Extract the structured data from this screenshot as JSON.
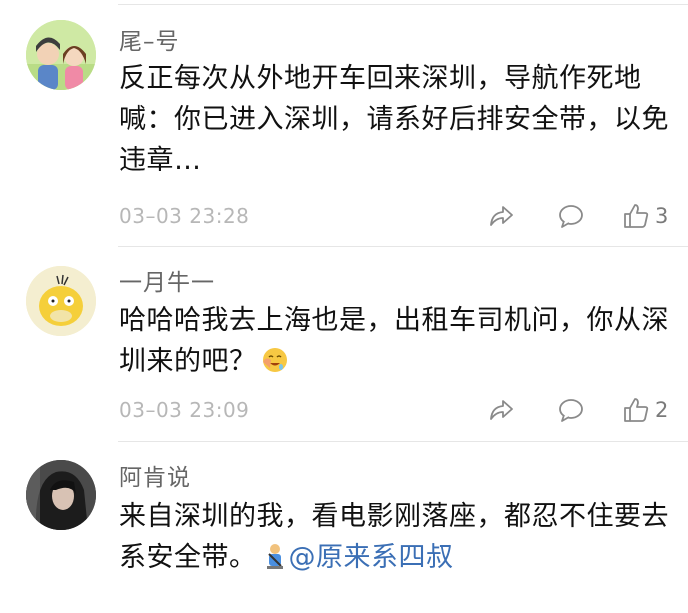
{
  "comments": [
    {
      "username": "尾–号",
      "text": "反正每次从外地开车回来深圳，导航作死地喊：你已进入深圳，请系好后排安全带，以免违章…",
      "time": "03–03 23:28",
      "likes": "3",
      "avatar_icon": "cartoon-couple-avatar"
    },
    {
      "username": "一月牛一",
      "text": "哈哈哈我去上海也是，出租车司机问，你从深圳来的吧？",
      "emoji": "drooling-face-emoji",
      "time": "03–03 23:09",
      "likes": "2",
      "avatar_icon": "psyduck-avatar"
    },
    {
      "username": "阿肯说",
      "text": "来自深圳的我，看电影刚落座，都忍不住要去系安全带。",
      "emoji": "seat-belt-figure-emoji",
      "mention": "@原来系四叔",
      "avatar_icon": "woman-photo-avatar"
    }
  ],
  "colors": {
    "text": "#111111",
    "username": "#666666",
    "meta": "#b7b7b7",
    "mention": "#3b6fb5",
    "divider": "#e6e6e6"
  }
}
